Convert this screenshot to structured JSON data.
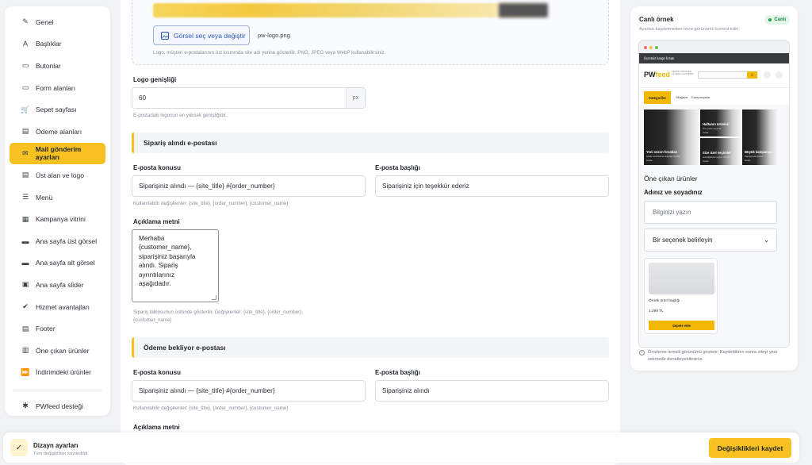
{
  "sidebar": {
    "items": [
      {
        "label": "Genel",
        "icon": "pin-icon",
        "glyph": "✎"
      },
      {
        "label": "Başlıklar",
        "icon": "text-icon",
        "glyph": "A"
      },
      {
        "label": "Butonlar",
        "icon": "button-icon",
        "glyph": "▭"
      },
      {
        "label": "Form alanları",
        "icon": "form-icon",
        "glyph": "▭"
      },
      {
        "label": "Sepet sayfası",
        "icon": "cart-icon",
        "glyph": "🛒"
      },
      {
        "label": "Ödeme alanları",
        "icon": "payment-icon",
        "glyph": "▤"
      },
      {
        "label": "Mail gönderim ayarları",
        "icon": "mail-icon",
        "glyph": "✉"
      },
      {
        "label": "Üst alan ve logo",
        "icon": "header-icon",
        "glyph": "▤"
      },
      {
        "label": "Menü",
        "icon": "menu-icon",
        "glyph": "☰"
      },
      {
        "label": "Kampanya vitrini",
        "icon": "grid-icon",
        "glyph": "▦"
      },
      {
        "label": "Ana sayfa üst görsel",
        "icon": "image-icon",
        "glyph": "▬"
      },
      {
        "label": "Ana sayfa alt görsel",
        "icon": "image-icon",
        "glyph": "▬"
      },
      {
        "label": "Ana sayfa slider",
        "icon": "slider-icon",
        "glyph": "▣"
      },
      {
        "label": "Hizmet avantajları",
        "icon": "check-circle-icon",
        "glyph": "✔"
      },
      {
        "label": "Footer",
        "icon": "footer-icon",
        "glyph": "▤"
      },
      {
        "label": "Öne çıkan ürünler",
        "icon": "bag-icon",
        "glyph": "▥"
      },
      {
        "label": "İndirimdeki ürünler",
        "icon": "forward-icon",
        "glyph": "⏩"
      }
    ],
    "active_index": 6,
    "support": {
      "label": "PWfeed desteği",
      "icon": "support-icon",
      "glyph": "✱"
    }
  },
  "logo_section": {
    "choose_button": "Görsel seç veya değiştir",
    "file_name": "pw-logo.png",
    "hint": "Logo, müşteri e-postalarının üst kısmında site adı yerine gösterilir. PNG, JPEG veya WebP kullanabilirsiniz.",
    "width_label": "Logo genişliği",
    "width_value": "60",
    "width_unit": "px",
    "width_hint": "E-postadaki logonun en yüksek genişliğidir."
  },
  "order_received": {
    "heading": "Sipariş alındı e-postası",
    "subject_label": "E-posta konusu",
    "subject_value": "Siparişiniz alındı — {site_title} #{order_number}",
    "title_label": "E-posta başlığı",
    "title_value": "Siparişiniz için teşekkür ederiz",
    "vars_hint": "Kullanılabilir değişkenler: {site_title}, {order_number}, {customer_name}",
    "desc_label": "Açıklama metni",
    "desc_lines": [
      "Merhaba",
      "{customer_name},",
      "siparişiniz başarıyla",
      "alındı. Sipariş",
      "ayrıntılarınız",
      "aşağıdadır."
    ],
    "desc_hint_1": "Sipariş tablosunun üstünde gösterilir. Değişkenler: {site_title}, {order_number},",
    "desc_hint_2": "{customer_name}"
  },
  "payment_pending": {
    "heading": "Ödeme bekliyor e-postası",
    "subject_label": "E-posta konusu",
    "subject_value": "Siparişiniz alındı — {site_title} #{order_number}",
    "title_label": "E-posta başlığı",
    "title_value": "Siparişiniz alındı",
    "vars_hint": "Kullanılabilir değişkenler: {site_title}, {order_number}, {customer_name}",
    "desc_label": "Açıklama metni"
  },
  "preview": {
    "title": "Canlı örnek",
    "subtitle": "Ayarları kaydetmeden önce görünümü kontrol edin.",
    "badge": "Canlı",
    "top_bar": "Ücretsiz kargo fırsatı",
    "logo_main": "PW",
    "logo_accent": "feed",
    "logo_tagline": "SEÇKİN ÜRÜNLER GÜVENLİ ALIŞVERİŞ",
    "search_glyph": "⌕",
    "nav": [
      "Kategoriler",
      "Mağaza",
      "Kampanyalar"
    ],
    "hero": [
      {
        "title": "Yeni sezon fırsatları",
        "sub": "Çoklu kombinlerle avantajlı fiyatlar",
        "cta": "İncele"
      },
      {
        "title": "Haftanın ürünleri",
        "sub": "Öne çıkan seçimler",
        "cta": "İncele"
      },
      {
        "title": "Size özel seçimler",
        "sub": "Günlüğünüze uygun ürünler",
        "cta": "İncele"
      },
      {
        "title": "Büyük kampanya",
        "sub": "Kampanyalı ürünler",
        "cta": "İncele"
      }
    ],
    "featured": "Öne çıkan ürünler",
    "name_label": "Adınız ve soyadınız",
    "input_placeholder": "Bilginizi yazın",
    "select_placeholder": "Bir seçenek belirleyin",
    "card_name": "Örnek ürün başlığı",
    "card_price": "1.299 TL",
    "card_button": "Sepete ekle",
    "note": "Önizleme temsili görünümü gösterir. Kaydettikten sonra siteyi yeni sekmede denetleyebilirsiniz."
  },
  "bottom": {
    "title": "Dizayn ayarları",
    "subtitle": "Tüm değişiklikler kaydedildi",
    "save_button": "Değişiklikleri kaydet"
  },
  "colors": {
    "accent": "#f7c221",
    "link": "#2a55b5",
    "live": "#22a04c"
  }
}
